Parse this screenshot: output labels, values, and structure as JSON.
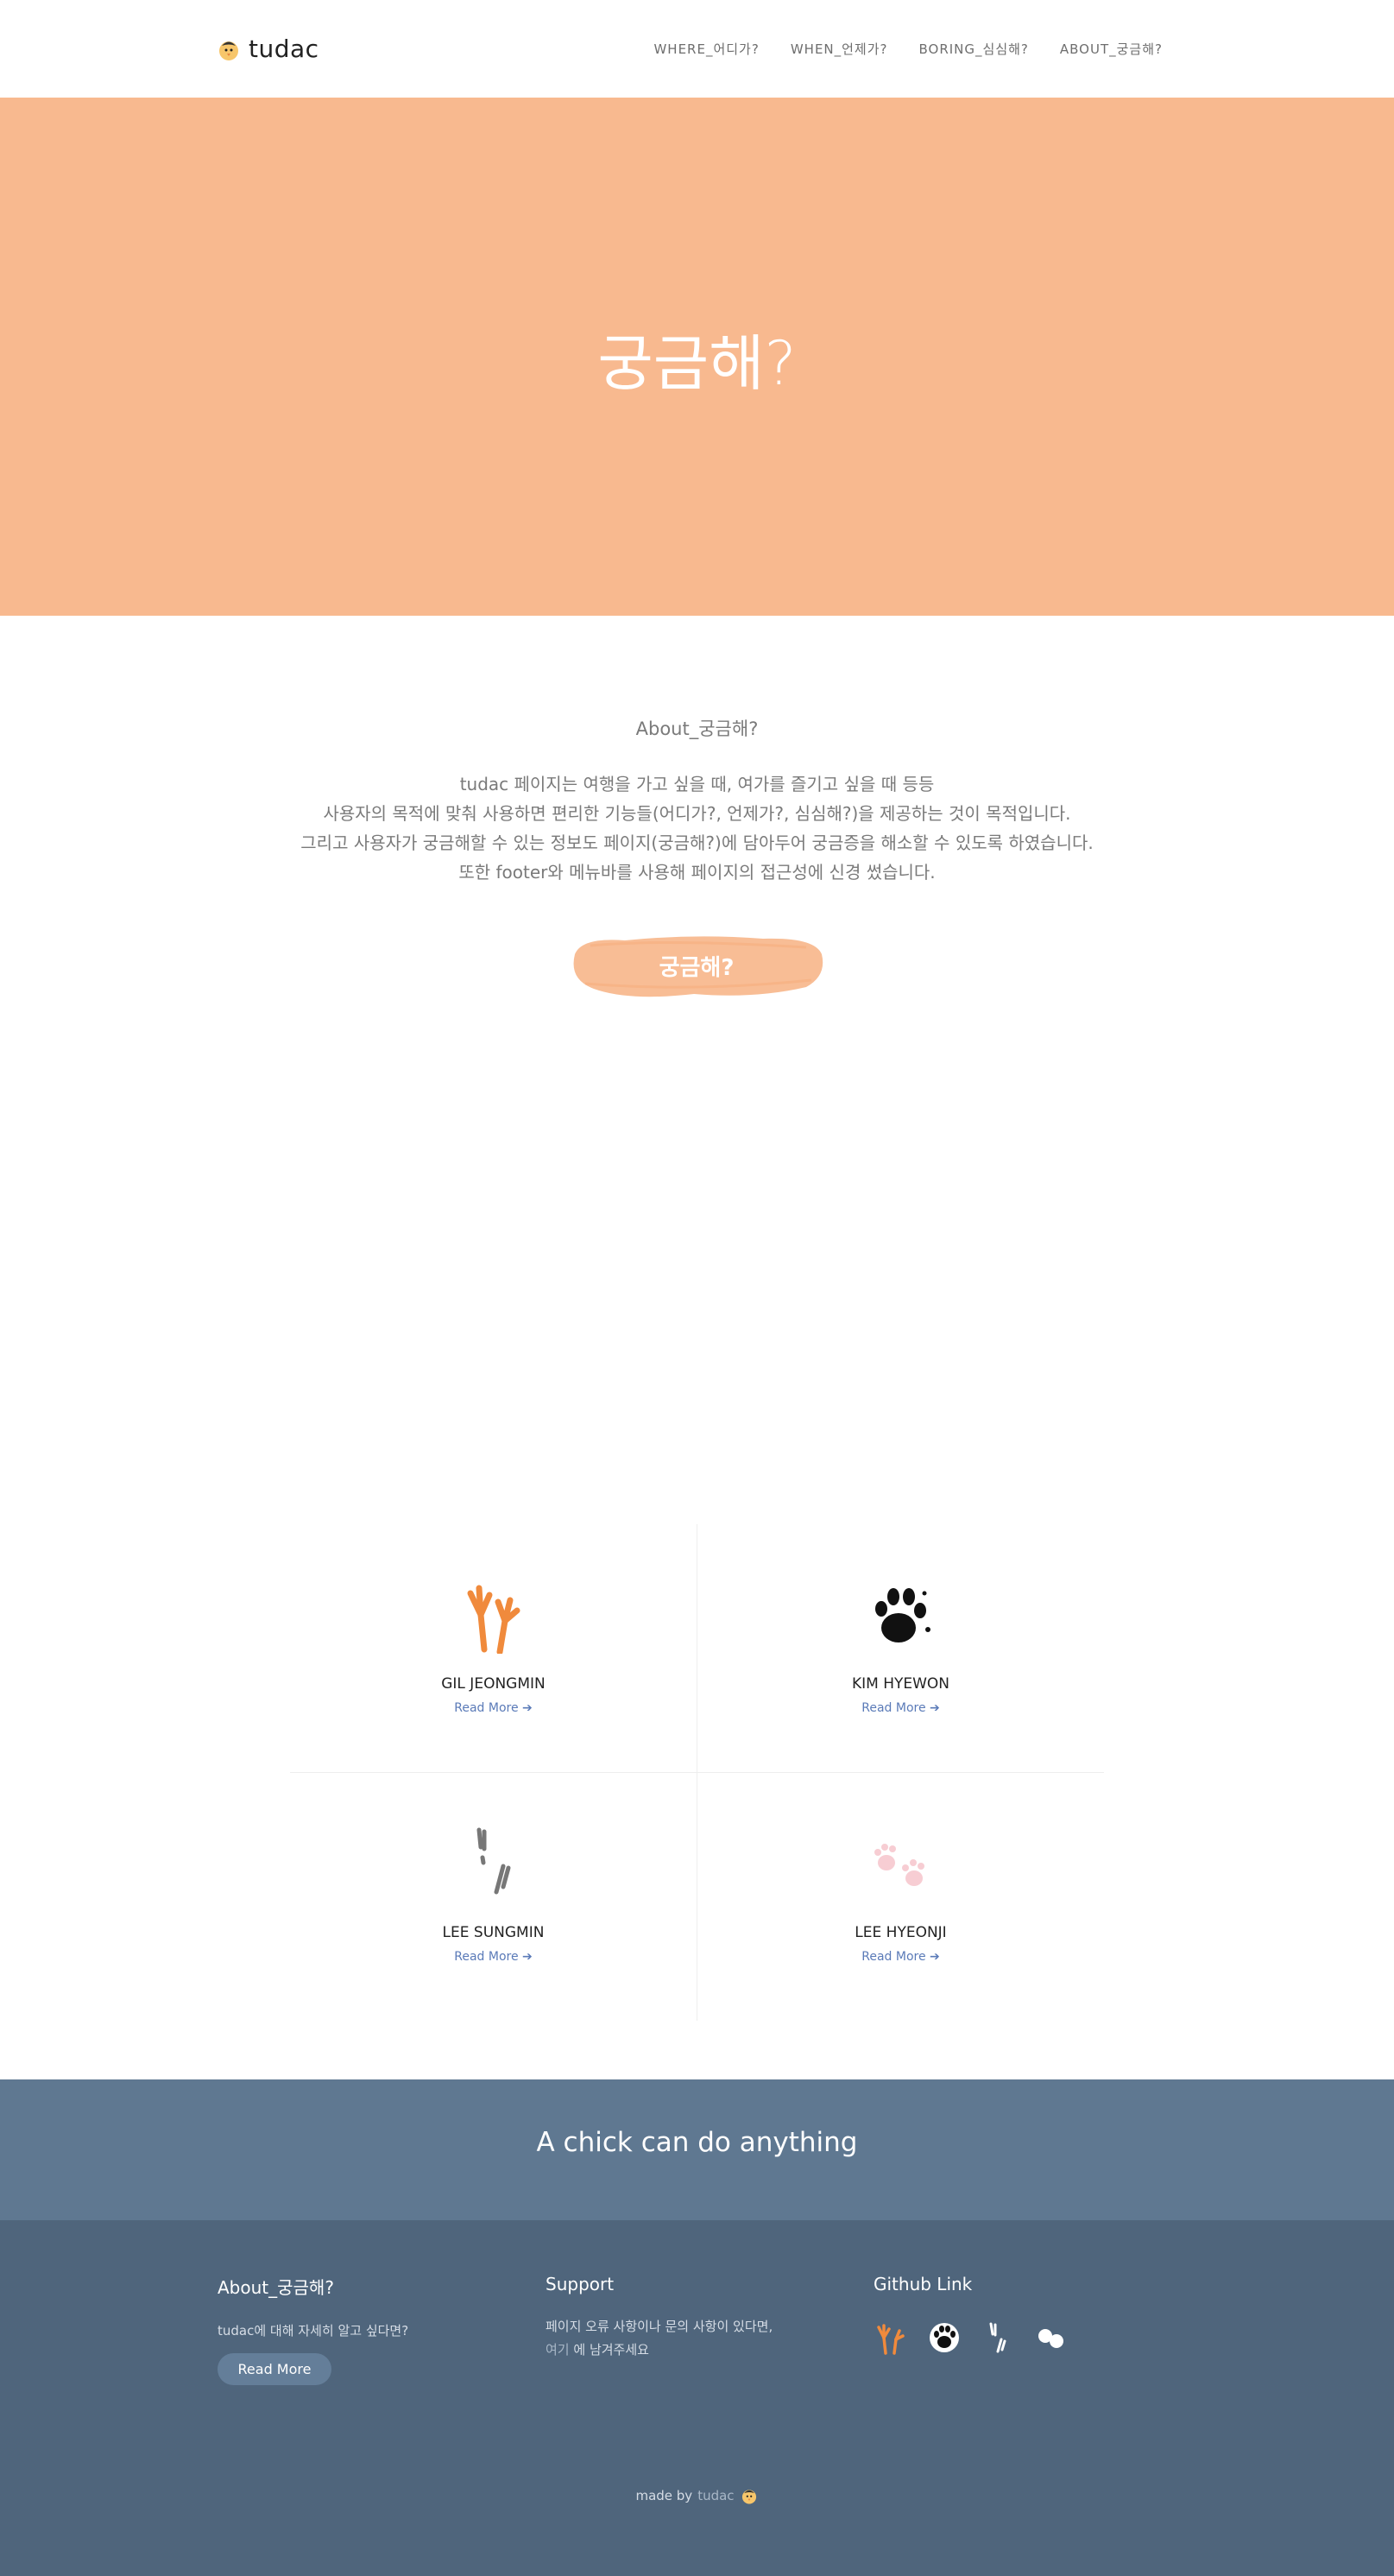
{
  "nav": {
    "brand": "tudac",
    "links": [
      "WHERE_어디가?",
      "WHEN_언제가?",
      "BORING_심심해?",
      "ABOUT_궁금해?"
    ]
  },
  "hero": {
    "title": "궁금해?"
  },
  "about": {
    "heading": "About_궁금해?",
    "lines": [
      "tudac 페이지는 여행을 가고 싶을 때, 여가를 즐기고 싶을 때 등등",
      "사용자의 목적에 맞춰 사용하면 편리한 기능들(어디가?, 언제가?, 심심해?)을 제공하는 것이 목적입니다.",
      "그리고 사용자가 궁금해할 수 있는 정보도 페이지(궁금해?)에 담아두어 궁금증을 해소할 수 있도록 하였습니다.",
      "또한 footer와 메뉴바를 사용해 페이지의 접근성에 신경 썼습니다."
    ],
    "cta": "궁금해?"
  },
  "team": [
    {
      "name": "GIL JEONGMIN",
      "more": "Read More",
      "icon": "orange-bird-foot-icon"
    },
    {
      "name": "KIM HYEWON",
      "more": "Read More",
      "icon": "black-paw-icon"
    },
    {
      "name": "LEE SUNGMIN",
      "more": "Read More",
      "icon": "hoof-prints-icon"
    },
    {
      "name": "LEE HYEONJI",
      "more": "Read More",
      "icon": "pink-paws-icon"
    }
  ],
  "band": {
    "text": "A chick can do anything"
  },
  "footer": {
    "about": {
      "title": "About_궁금해?",
      "text": "tudac에 대해 자세히 알고 싶다면?",
      "button": "Read More"
    },
    "support": {
      "title": "Support",
      "line1": "페이지 오류 사항이나 문의 사항이 있다면,",
      "link": "여기",
      "line2": " 에 남겨주세요"
    },
    "github": {
      "title": "Github Link"
    },
    "made_by": "made by",
    "brand": "tudac"
  },
  "colors": {
    "hero": "#f8b98f",
    "band": "#5f7891",
    "footer": "#4f657c",
    "accent_orange": "#f08a3c"
  }
}
